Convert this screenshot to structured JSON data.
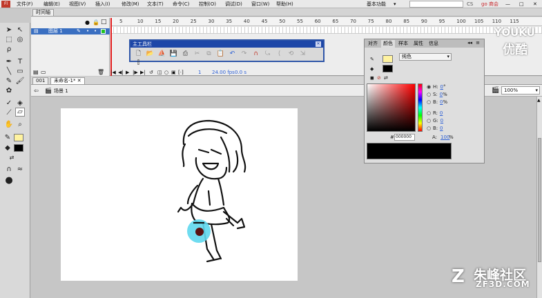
{
  "menu": {
    "items": [
      "文件(F)",
      "编辑(E)",
      "视图(V)",
      "插入(I)",
      "修改(M)",
      "文本(T)",
      "命令(C)",
      "控制(O)",
      "调试(D)",
      "窗口(W)",
      "帮助(H)"
    ],
    "workspace": "基本功能",
    "cs_label": "CS",
    "brand": "go 商会"
  },
  "timeline": {
    "panel_tab": "时间轴",
    "layer_name": "图层 1",
    "ruler": [
      "5",
      "10",
      "15",
      "20",
      "25",
      "30",
      "35",
      "40",
      "45",
      "50",
      "55",
      "60",
      "65",
      "70",
      "75",
      "80",
      "85",
      "90",
      "95",
      "100",
      "105",
      "110",
      "115"
    ],
    "frame_number": "1",
    "fps": "24.00 fps",
    "time": "0.0 s"
  },
  "main_toolbar": {
    "title": "主工具栏",
    "icons": [
      "new-file-icon",
      "open-icon",
      "bridge-icon",
      "save-icon",
      "print-icon",
      "cut-icon",
      "copy-icon",
      "paste-icon",
      "undo-icon",
      "redo-icon",
      "snap-icon",
      "smooth-icon",
      "straighten-icon",
      "rotate-icon",
      "scale-icon",
      "align-icon"
    ]
  },
  "doc": {
    "tab_id": "001",
    "tab_label": "未命名-1*",
    "scene": "场景 1",
    "zoom": "100%"
  },
  "color_panel": {
    "tabs": [
      "对齐",
      "颜色",
      "样本",
      "属性",
      "信息"
    ],
    "active_tab": "颜色",
    "fill_type": "纯色",
    "h_label": "H:",
    "h_value": "0",
    "h_unit": "°",
    "s_label": "S:",
    "s_value": "0",
    "s_unit": "%",
    "b_label": "B:",
    "b_value": "0",
    "b_unit": "%",
    "r_label": "R:",
    "r_value": "0",
    "g_label": "G:",
    "g_value": "0",
    "bl_label": "B:",
    "bl_value": "0",
    "hex_prefix": "#",
    "hex_value": "000000",
    "alpha_label": "A:",
    "alpha_value": "100",
    "alpha_unit": "%",
    "stroke_color": "#fff3a0",
    "fill_color": "#000000"
  },
  "watermarks": {
    "youku": "YOUKU",
    "youku_cn": "优酷",
    "site_cn": "朱峰社区",
    "site_en": "ZF3D.COM"
  }
}
